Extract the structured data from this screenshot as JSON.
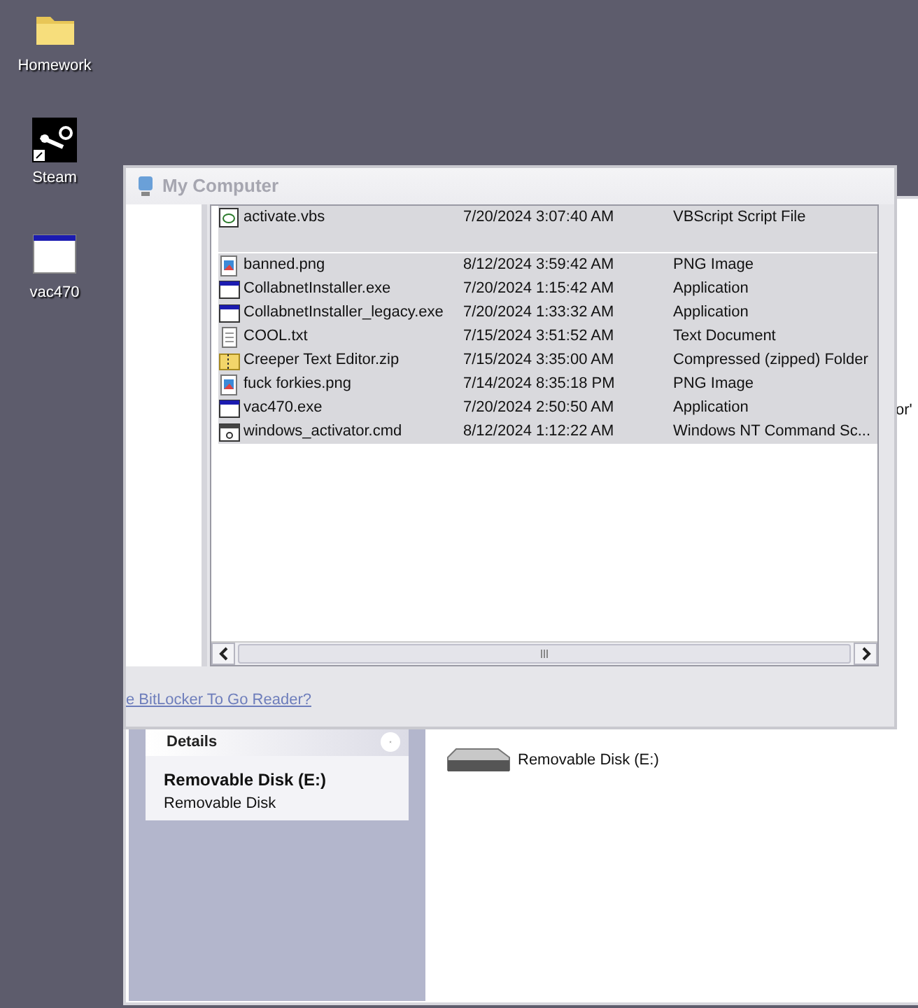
{
  "desktop_icons": [
    {
      "label": "Homework",
      "kind": "folder"
    },
    {
      "label": "Steam",
      "kind": "steam"
    },
    {
      "label": "vac470",
      "kind": "window"
    }
  ],
  "back_window": {
    "details": {
      "title": "Details",
      "name": "Removable Disk (E:)",
      "type": "Removable Disk"
    },
    "drives": [
      {
        "label": "Removable Disk (E:)"
      }
    ],
    "side_text": "or'"
  },
  "front_window": {
    "title": "My Computer",
    "files": [
      {
        "name": "activate.vbs",
        "date": "7/20/2024 3:07:40 AM",
        "type": "VBScript Script File",
        "kind": "script",
        "selected": true
      },
      {
        "name": "banned.png",
        "date": "8/12/2024 3:59:42 AM",
        "type": "PNG Image",
        "kind": "image",
        "selected": true
      },
      {
        "name": "CollabnetInstaller.exe",
        "date": "7/20/2024 1:15:42 AM",
        "type": "Application",
        "kind": "app",
        "selected": true
      },
      {
        "name": "CollabnetInstaller_legacy.exe",
        "date": "7/20/2024 1:33:32 AM",
        "type": "Application",
        "kind": "app",
        "selected": true
      },
      {
        "name": "COOL.txt",
        "date": "7/15/2024 3:51:52 AM",
        "type": "Text Document",
        "kind": "text",
        "selected": true
      },
      {
        "name": "Creeper Text Editor.zip",
        "date": "7/15/2024 3:35:00 AM",
        "type": "Compressed (zipped) Folder",
        "kind": "zip",
        "selected": true
      },
      {
        "name": "fuck forkies.png",
        "date": "7/14/2024 8:35:18 PM",
        "type": "PNG Image",
        "kind": "image",
        "selected": true
      },
      {
        "name": "vac470.exe",
        "date": "7/20/2024 2:50:50 AM",
        "type": "Application",
        "kind": "app",
        "selected": true
      },
      {
        "name": "windows_activator.cmd",
        "date": "8/12/2024 1:12:22 AM",
        "type": "Windows NT Command Sc...",
        "kind": "cmd",
        "selected": true
      }
    ],
    "link": "e BitLocker To Go Reader?"
  }
}
